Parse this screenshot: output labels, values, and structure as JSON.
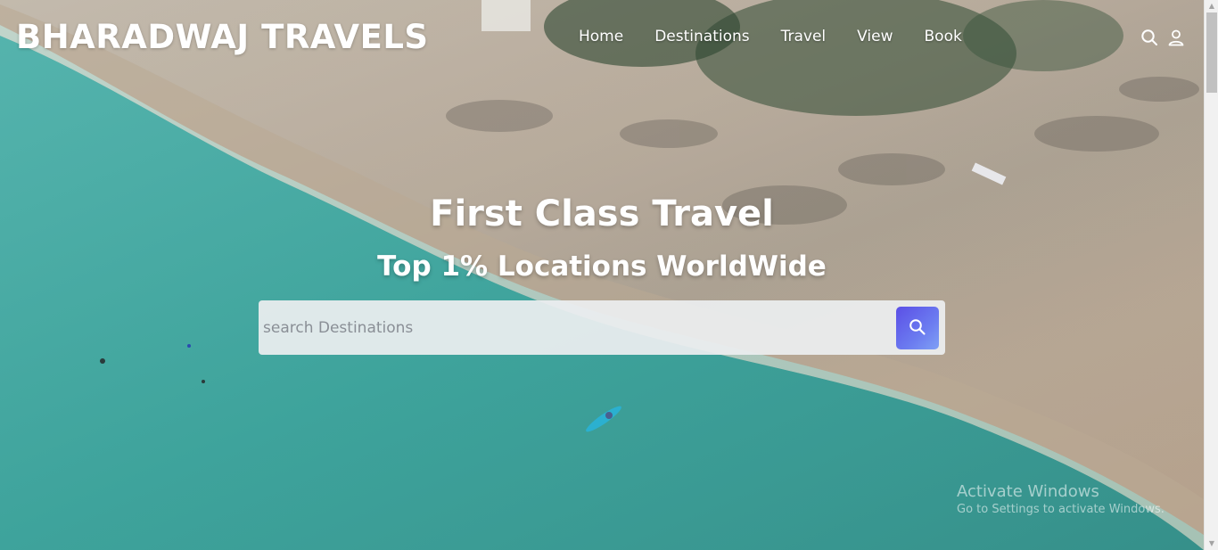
{
  "brand": {
    "logo_text": "BHARADWAJ TRAVELS"
  },
  "nav": {
    "items": [
      {
        "label": "Home"
      },
      {
        "label": "Destinations"
      },
      {
        "label": "Travel"
      },
      {
        "label": "View"
      },
      {
        "label": "Book"
      }
    ]
  },
  "header_icons": [
    "search-icon",
    "user-icon"
  ],
  "hero": {
    "title": "First Class Travel",
    "subtitle": "Top 1% Locations WorldWide"
  },
  "search": {
    "placeholder": "search Destinations",
    "value": "",
    "button_icon": "search-icon"
  },
  "watermark": {
    "title": "Activate Windows",
    "subtitle": "Go to Settings to activate Windows."
  },
  "colors": {
    "search_button": "#5b4fe6",
    "text": "#ffffff",
    "sea": "#3aa3a0",
    "sand": "#cdbfae"
  }
}
